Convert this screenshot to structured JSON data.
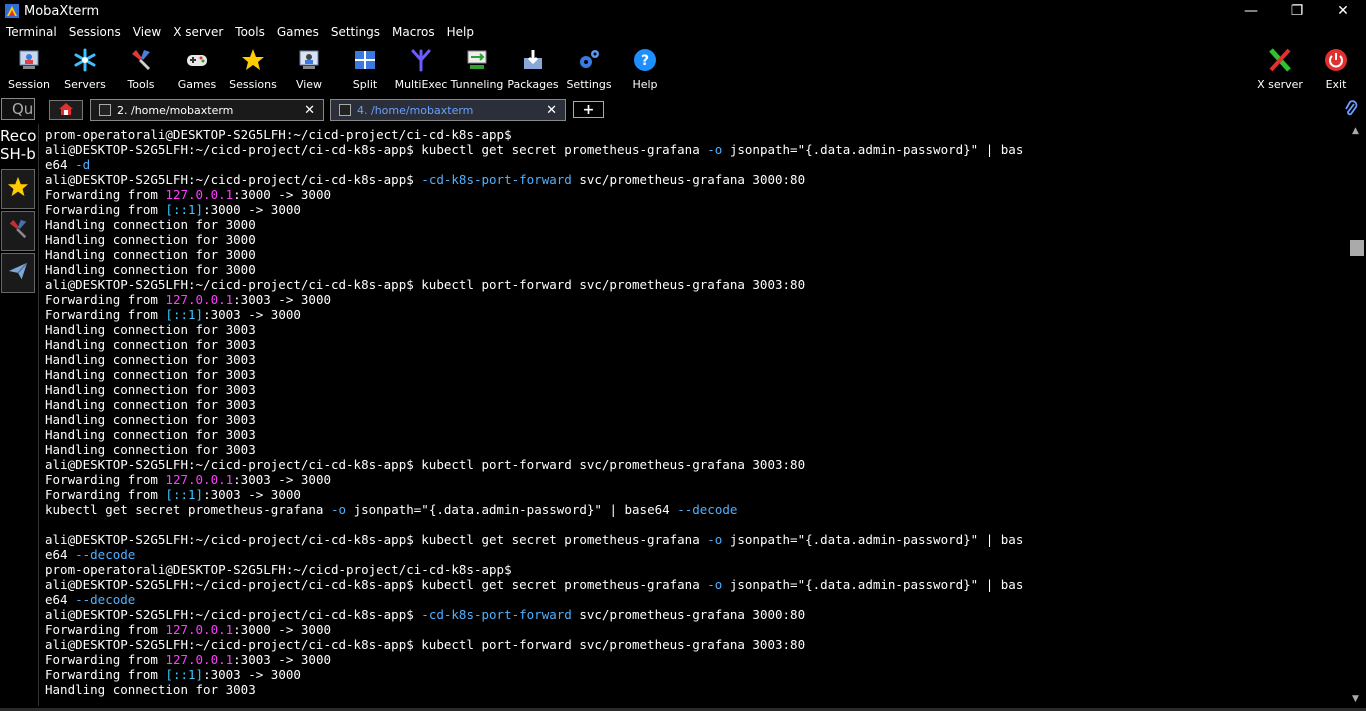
{
  "window": {
    "title": "MobaXterm",
    "minimize": "—",
    "restore": "❐",
    "close": "✕"
  },
  "menu": [
    "Terminal",
    "Sessions",
    "View",
    "X server",
    "Tools",
    "Games",
    "Settings",
    "Macros",
    "Help"
  ],
  "toolbar": {
    "session": "Session",
    "servers": "Servers",
    "tools": "Tools",
    "games": "Games",
    "sessions": "Sessions",
    "view": "View",
    "split": "Split",
    "multiexec": "MultiExec",
    "tunneling": "Tunneling",
    "packages": "Packages",
    "settings": "Settings",
    "help": "Help",
    "xserver": "X server",
    "exit": "Exit"
  },
  "tabs": {
    "quick_connect": "Qu",
    "tab1": {
      "label": "2. /home/mobaxterm",
      "close": "✕"
    },
    "tab2": {
      "label": "4. /home/mobaxterm",
      "close": "✕"
    },
    "new_tab": "+"
  },
  "sidebar": {
    "text1": "Reco",
    "text2": "SH-b"
  },
  "colors": {
    "blue": "#4fb0ff",
    "magenta": "#ff3cff",
    "cyan": "#3cc8ff",
    "white": "#ffffff"
  },
  "terminal": {
    "lines": [
      [
        [
          "w",
          "prom-operatorali@DESKTOP-S2G5LFH:~/cicd-project/ci-cd-k8s-app$"
        ]
      ],
      [
        [
          "w",
          "ali@DESKTOP-S2G5LFH:~/cicd-project/ci-cd-k8s-app$ kubectl get secret prometheus-grafana "
        ],
        [
          "b",
          "-o"
        ],
        [
          "w",
          " jsonpath=\"{.data.admin-password}\" | bas"
        ]
      ],
      [
        [
          "w",
          "e64 "
        ],
        [
          "b",
          "-d"
        ]
      ],
      [
        [
          "w",
          "ali@DESKTOP-S2G5LFH:~/cicd-project/ci-cd-k8s-app$ "
        ],
        [
          "b",
          "-cd-k8s-port-forward"
        ],
        [
          "w",
          " svc/prometheus-grafana 3000:80"
        ]
      ],
      [
        [
          "w",
          "Forwarding from "
        ],
        [
          "m",
          "127.0.0.1"
        ],
        [
          "w",
          ":3000 -> 3000"
        ]
      ],
      [
        [
          "w",
          "Forwarding from "
        ],
        [
          "c",
          "[::1]"
        ],
        [
          "w",
          ":3000 -> 3000"
        ]
      ],
      [
        [
          "w",
          "Handling connection for 3000"
        ]
      ],
      [
        [
          "w",
          "Handling connection for 3000"
        ]
      ],
      [
        [
          "w",
          "Handling connection for 3000"
        ]
      ],
      [
        [
          "w",
          "Handling connection for 3000"
        ]
      ],
      [
        [
          "w",
          "ali@DESKTOP-S2G5LFH:~/cicd-project/ci-cd-k8s-app$ kubectl port-forward svc/prometheus-grafana 3003:80"
        ]
      ],
      [
        [
          "w",
          "Forwarding from "
        ],
        [
          "m",
          "127.0.0.1"
        ],
        [
          "w",
          ":3003 -> 3000"
        ]
      ],
      [
        [
          "w",
          "Forwarding from "
        ],
        [
          "c",
          "[::1]"
        ],
        [
          "w",
          ":3003 -> 3000"
        ]
      ],
      [
        [
          "w",
          "Handling connection for 3003"
        ]
      ],
      [
        [
          "w",
          "Handling connection for 3003"
        ]
      ],
      [
        [
          "w",
          "Handling connection for 3003"
        ]
      ],
      [
        [
          "w",
          "Handling connection for 3003"
        ]
      ],
      [
        [
          "w",
          "Handling connection for 3003"
        ]
      ],
      [
        [
          "w",
          "Handling connection for 3003"
        ]
      ],
      [
        [
          "w",
          "Handling connection for 3003"
        ]
      ],
      [
        [
          "w",
          "Handling connection for 3003"
        ]
      ],
      [
        [
          "w",
          "Handling connection for 3003"
        ]
      ],
      [
        [
          "w",
          "ali@DESKTOP-S2G5LFH:~/cicd-project/ci-cd-k8s-app$ kubectl port-forward svc/prometheus-grafana 3003:80"
        ]
      ],
      [
        [
          "w",
          "Forwarding from "
        ],
        [
          "m",
          "127.0.0.1"
        ],
        [
          "w",
          ":3003 -> 3000"
        ]
      ],
      [
        [
          "w",
          "Forwarding from "
        ],
        [
          "c",
          "[::1]"
        ],
        [
          "w",
          ":3003 -> 3000"
        ]
      ],
      [
        [
          "w",
          "kubectl get secret prometheus-grafana "
        ],
        [
          "b",
          "-o"
        ],
        [
          "w",
          " jsonpath=\"{.data.admin-password}\" | base64 "
        ],
        [
          "b",
          "--decode"
        ]
      ],
      [
        [
          "w",
          ""
        ]
      ],
      [
        [
          "w",
          "ali@DESKTOP-S2G5LFH:~/cicd-project/ci-cd-k8s-app$ kubectl get secret prometheus-grafana "
        ],
        [
          "b",
          "-o"
        ],
        [
          "w",
          " jsonpath=\"{.data.admin-password}\" | bas"
        ]
      ],
      [
        [
          "w",
          "e64 "
        ],
        [
          "b",
          "--decode"
        ]
      ],
      [
        [
          "w",
          "prom-operatorali@DESKTOP-S2G5LFH:~/cicd-project/ci-cd-k8s-app$"
        ]
      ],
      [
        [
          "w",
          "ali@DESKTOP-S2G5LFH:~/cicd-project/ci-cd-k8s-app$ kubectl get secret prometheus-grafana "
        ],
        [
          "b",
          "-o"
        ],
        [
          "w",
          " jsonpath=\"{.data.admin-password}\" | bas"
        ]
      ],
      [
        [
          "w",
          "e64 "
        ],
        [
          "b",
          "--decode"
        ]
      ],
      [
        [
          "w",
          "ali@DESKTOP-S2G5LFH:~/cicd-project/ci-cd-k8s-app$ "
        ],
        [
          "b",
          "-cd-k8s-port-forward"
        ],
        [
          "w",
          " svc/prometheus-grafana 3000:80"
        ]
      ],
      [
        [
          "w",
          "Forwarding from "
        ],
        [
          "m",
          "127.0.0.1"
        ],
        [
          "w",
          ":3000 -> 3000"
        ]
      ],
      [
        [
          "w",
          "ali@DESKTOP-S2G5LFH:~/cicd-project/ci-cd-k8s-app$ kubectl port-forward svc/prometheus-grafana 3003:80"
        ]
      ],
      [
        [
          "w",
          "Forwarding from "
        ],
        [
          "m",
          "127.0.0.1"
        ],
        [
          "w",
          ":3003 -> 3000"
        ]
      ],
      [
        [
          "w",
          "Forwarding from "
        ],
        [
          "c",
          "[::1]"
        ],
        [
          "w",
          ":3003 -> 3000"
        ]
      ],
      [
        [
          "w",
          "Handling connection for 3003"
        ]
      ]
    ]
  }
}
